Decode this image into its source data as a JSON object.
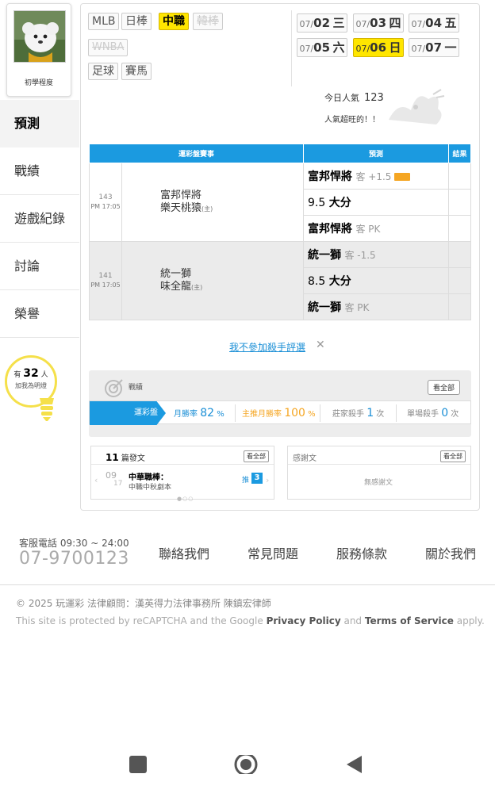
{
  "sidebar": {
    "avatar_label": "初學程度",
    "nav": [
      {
        "label": "預測",
        "active": true
      },
      {
        "label": "戰績"
      },
      {
        "label": "遊戲紀錄"
      },
      {
        "label": "討論"
      },
      {
        "label": "榮譽"
      }
    ],
    "bulb": {
      "prefix": "有",
      "count": "32",
      "suffix": "人",
      "line2": "加我為明燈"
    }
  },
  "leagues": [
    {
      "label": "MLB"
    },
    {
      "label": "日棒"
    },
    {
      "label": "中職",
      "active": true
    },
    {
      "label": "韓棒",
      "disabled": true
    },
    {
      "label": "WNBA",
      "disabled": true
    },
    {
      "label": "足球"
    },
    {
      "label": "賽馬"
    }
  ],
  "dates": [
    {
      "md": "07/",
      "d": "02",
      "w": "三"
    },
    {
      "md": "07/",
      "d": "03",
      "w": "四"
    },
    {
      "md": "07/",
      "d": "04",
      "w": "五"
    },
    {
      "md": "07/",
      "d": "05",
      "w": "六"
    },
    {
      "md": "07/",
      "d": "06",
      "w": "日",
      "active": true
    },
    {
      "md": "07/",
      "d": "07",
      "w": "一"
    }
  ],
  "popularity": {
    "label": "今日人氣",
    "value": "123",
    "note": "人氣超旺的！！"
  },
  "table": {
    "headers": [
      "運彩盤賽事",
      "預測",
      "結果"
    ],
    "games": [
      {
        "num": "143",
        "time": "PM 17:05",
        "team1": "富邦悍將",
        "team2": "樂天桃猿",
        "home_tag": "(主)",
        "preds": [
          {
            "main": "富邦悍將",
            "sub": "客 +1.5",
            "tag": true
          },
          {
            "main": "9.5",
            "sub": "",
            "bold": "大分"
          },
          {
            "main": "富邦悍將",
            "sub": "客 PK"
          }
        ]
      },
      {
        "num": "141",
        "time": "PM 17:05",
        "team1": "統一獅",
        "team2": "味全龍",
        "home_tag": "(主)",
        "preds": [
          {
            "main": "統一獅",
            "sub": "客 -1.5"
          },
          {
            "main": "8.5",
            "sub": "",
            "bold": "大分"
          },
          {
            "main": "統一獅",
            "sub": "客 PK"
          }
        ]
      }
    ]
  },
  "optout": {
    "label": "我不參加殺手評選",
    "close": "✕"
  },
  "record": {
    "title": "戰績",
    "view_all": "看全部",
    "tab": "運彩盤",
    "monthly_label": "月勝率",
    "monthly_value": "82",
    "monthly_unit": "%",
    "main_label": "主推月勝率",
    "main_value": "100",
    "main_unit": "%",
    "banker_label": "莊家殺手",
    "banker_value": "1",
    "banker_unit": "次",
    "single_label": "單場殺手",
    "single_value": "0",
    "single_unit": "次"
  },
  "posts": {
    "count": "11",
    "label": "篇發文",
    "view_all": "看全部",
    "item": {
      "date_m": "09",
      "date_d": "17",
      "title": "中華職棒：",
      "sub": "中職中秋劇本",
      "push_label": "推",
      "push_count": "3"
    }
  },
  "thanks": {
    "label": "感謝文",
    "view_all": "看全部",
    "empty": "無感謝文"
  },
  "footer": {
    "phone_label": "客服電話 09:30 ~ 24:00",
    "phone": "07-9700123",
    "links": [
      "聯絡我們",
      "常見問題",
      "服務條款",
      "關於我們"
    ],
    "copyright": "© 2025 玩運彩 法律顧問：漢英得力法律事務所 陳鎮宏律師",
    "site_pre": "This site is protected by reCAPTCHA and the Google",
    "privacy": "Privacy Policy",
    "and": "and",
    "terms": "Terms of Service",
    "apply": "apply."
  },
  "colors": {
    "accent": "#1b9ae0",
    "highlight": "#ffe600",
    "orange": "#f5a623"
  },
  "icons": [
    "avatar",
    "target-icon",
    "lightbulb-icon",
    "chevron-left-icon",
    "chevron-right-icon",
    "square-nav-icon",
    "circle-nav-icon",
    "back-nav-icon"
  ]
}
